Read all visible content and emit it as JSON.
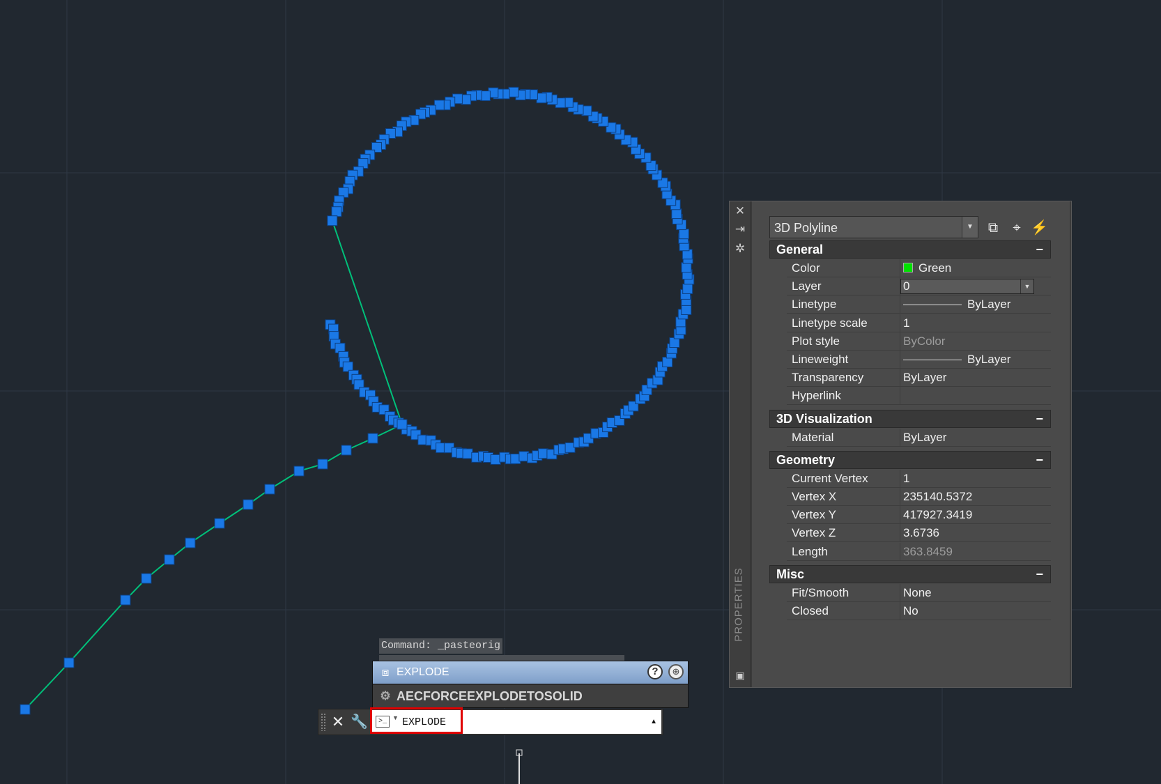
{
  "viewport": {
    "background": "#212830",
    "grid_color": "#2e3845",
    "polyline_color": "#00c07a",
    "grip_color": "#1a78e6"
  },
  "properties": {
    "palette_title": "PROPERTIES",
    "object_type": "3D Polyline",
    "sections": [
      {
        "title": "General",
        "collapse": "−",
        "rows": [
          {
            "label": "Color",
            "value": "Green",
            "kind": "color",
            "swatch": "#00e000"
          },
          {
            "label": "Layer",
            "value": "0",
            "kind": "dropdown"
          },
          {
            "label": "Linetype",
            "value": "ByLayer",
            "kind": "line"
          },
          {
            "label": "Linetype scale",
            "value": "1"
          },
          {
            "label": "Plot style",
            "value": "ByColor",
            "dim": true
          },
          {
            "label": "Lineweight",
            "value": "ByLayer",
            "kind": "line"
          },
          {
            "label": "Transparency",
            "value": "ByLayer"
          },
          {
            "label": "Hyperlink",
            "value": ""
          }
        ]
      },
      {
        "title": "3D Visualization",
        "collapse": "−",
        "rows": [
          {
            "label": "Material",
            "value": "ByLayer"
          }
        ]
      },
      {
        "title": "Geometry",
        "collapse": "−",
        "rows": [
          {
            "label": "Current Vertex",
            "value": "1"
          },
          {
            "label": "Vertex X",
            "value": "235140.5372"
          },
          {
            "label": "Vertex Y",
            "value": "417927.3419"
          },
          {
            "label": "Vertex Z",
            "value": "3.6736"
          },
          {
            "label": "Length",
            "value": "363.8459",
            "dim": true
          }
        ]
      },
      {
        "title": "Misc",
        "collapse": "−",
        "rows": [
          {
            "label": "Fit/Smooth",
            "value": "None"
          },
          {
            "label": "Closed",
            "value": "No"
          }
        ]
      }
    ]
  },
  "command": {
    "history": [
      "Command: _pasteorig"
    ],
    "autocomplete": [
      {
        "label": "EXPLODE",
        "icon": "explode-icon"
      },
      {
        "label": "AECFORCEEXPLODETOSOLID",
        "icon": "gear-icon"
      }
    ],
    "input_value": "EXPLODE"
  }
}
